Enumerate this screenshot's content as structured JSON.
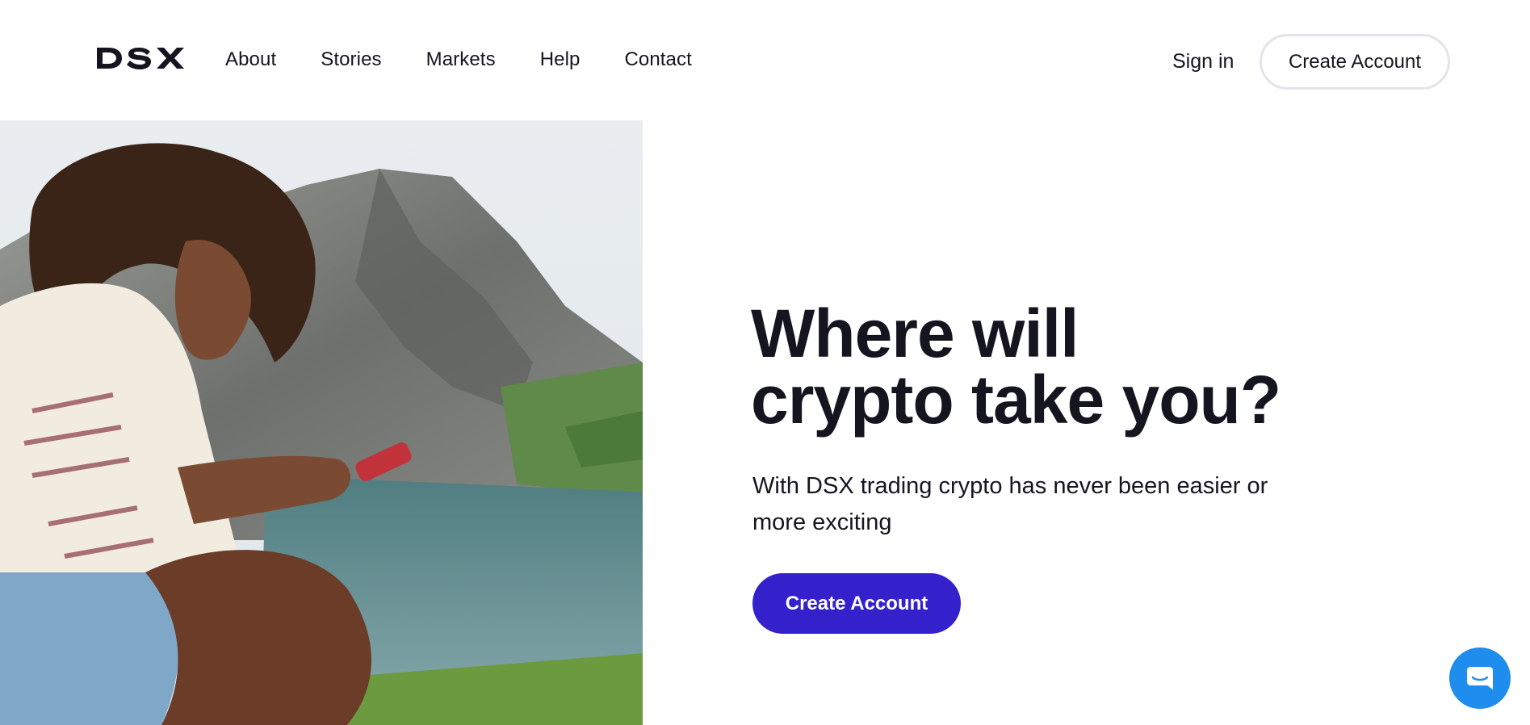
{
  "brand": {
    "logo_text": "DSX"
  },
  "nav": {
    "items": [
      {
        "label": "About"
      },
      {
        "label": "Stories"
      },
      {
        "label": "Markets"
      },
      {
        "label": "Help"
      },
      {
        "label": "Contact"
      }
    ]
  },
  "header": {
    "sign_in_label": "Sign in",
    "create_account_label": "Create Account"
  },
  "hero": {
    "headline_line1": "Where will",
    "headline_line2": "crypto take you?",
    "subtext": "With DSX trading crypto has never been easier or more exciting",
    "cta_label": "Create Account",
    "image_description_icon": "hero-photo"
  },
  "chat": {
    "icon": "chat-icon"
  },
  "colors": {
    "text": "#15151f",
    "accent": "#3421cc",
    "chat_blue": "#1f8ded",
    "outline": "#e3e3ec"
  }
}
